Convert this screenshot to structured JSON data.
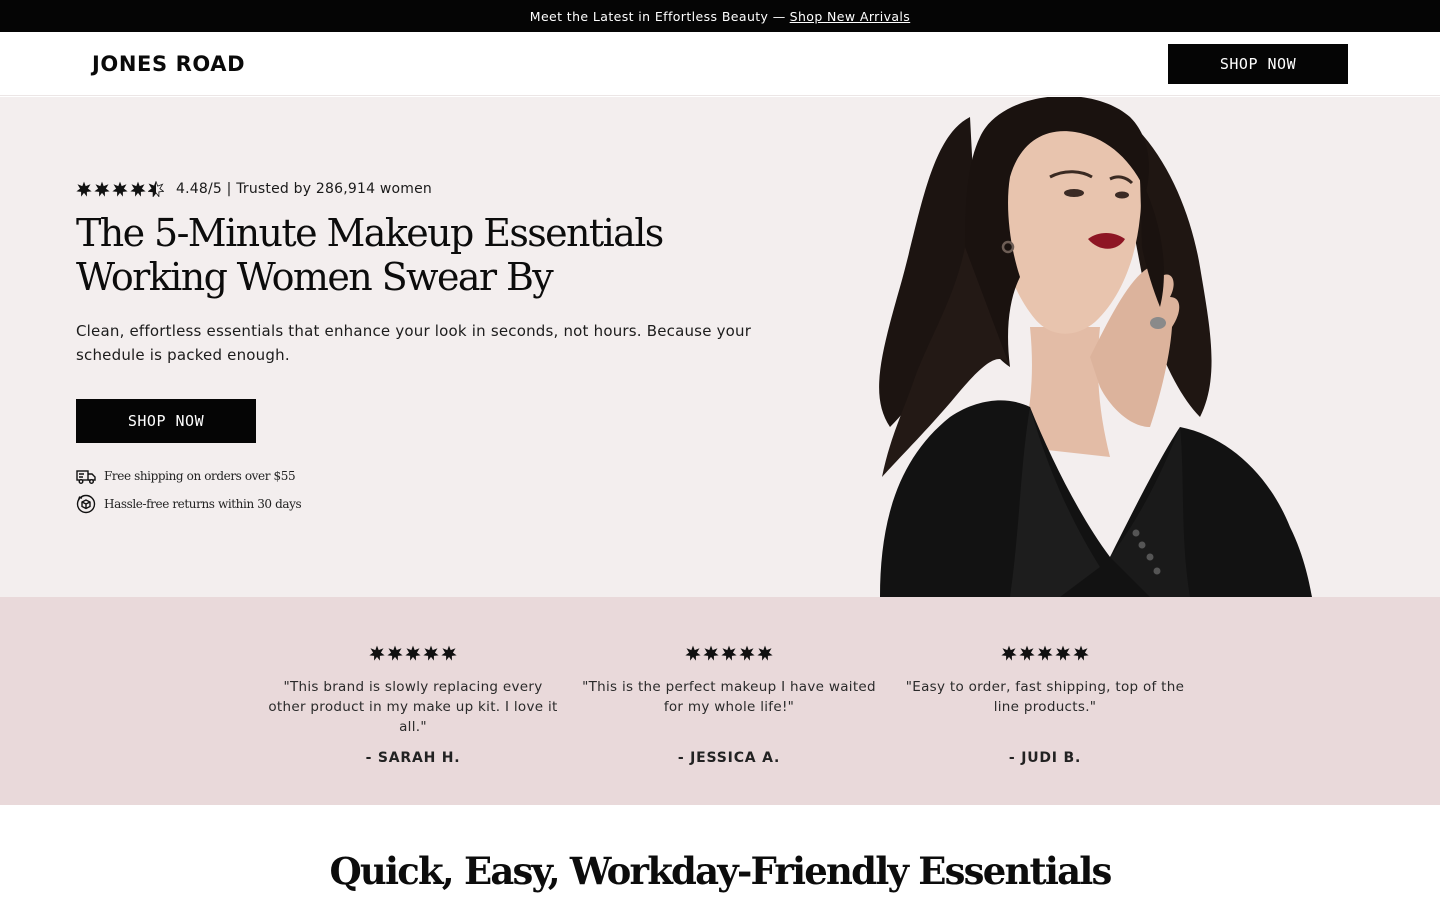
{
  "announcement": {
    "text": "Meet the Latest in Effortless Beauty —",
    "link": "Shop New Arrivals"
  },
  "header": {
    "logo": "JONES ROAD",
    "cta": "SHOP NOW"
  },
  "hero": {
    "rating": {
      "score": 4.48,
      "max": 5,
      "text": "4.48/5 | Trusted by 286,914 women"
    },
    "title": "The 5-Minute Makeup Essentials Working Women Swear By",
    "subtitle": "Clean, effortless essentials that enhance your look in seconds, not hours. Because your schedule is packed enough.",
    "cta": "SHOP NOW",
    "perks": [
      {
        "icon": "delivery-truck-icon",
        "text": "Free shipping on orders over $55"
      },
      {
        "icon": "returns-box-icon",
        "text": "Hassle-free returns within 30 days"
      }
    ]
  },
  "reviews": [
    {
      "stars": 5,
      "quote": "\"This brand is slowly replacing every other product in my make up kit. I love it all.\"",
      "author": "- SARAH H."
    },
    {
      "stars": 5,
      "quote": "\"This is the perfect makeup I have waited for my whole life!\"",
      "author": "- JESSICA A."
    },
    {
      "stars": 5,
      "quote": "\"Easy to order, fast shipping, top of the line products.\"",
      "author": "- JUDI B."
    }
  ],
  "section": {
    "title": "Quick, Easy, Workday-Friendly Essentials"
  },
  "colors": {
    "hero_bg": "#f3eeee",
    "reviews_bg": "#e9d9da",
    "button": "#050505"
  }
}
